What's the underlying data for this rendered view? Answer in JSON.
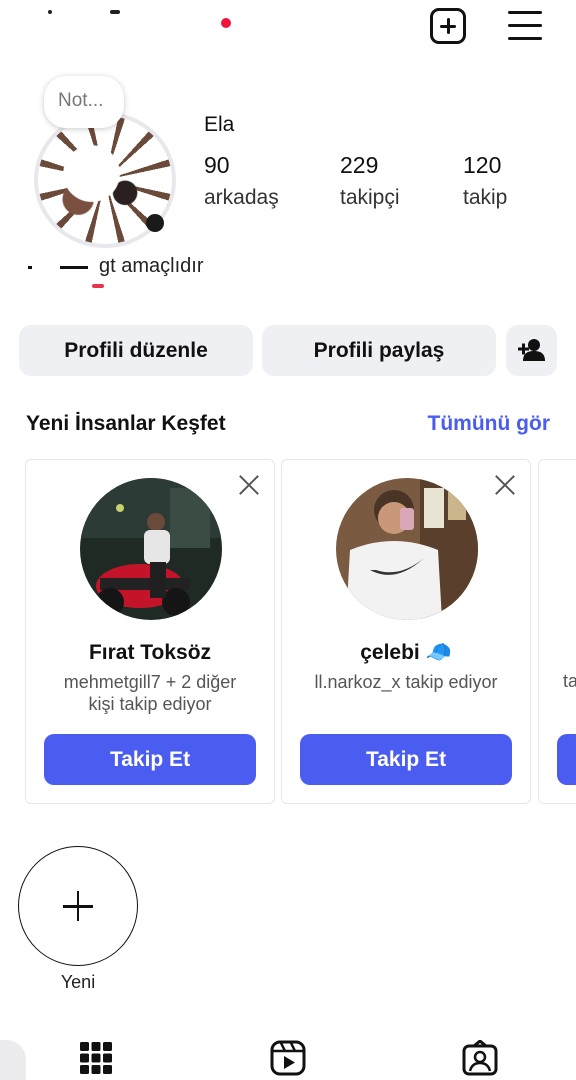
{
  "profile": {
    "note": "Not...",
    "name": "Ela",
    "bio": "gt amaçlıdır",
    "stats": [
      {
        "value": "90",
        "label": "arkadaş"
      },
      {
        "value": "229",
        "label": "takipçi"
      },
      {
        "value": "120",
        "label": "takip"
      }
    ]
  },
  "actions": {
    "edit_profile": "Profili düzenle",
    "share_profile": "Profili paylaş"
  },
  "discover": {
    "title": "Yeni İnsanlar Keşfet",
    "see_all": "Tümünü gör",
    "cards": [
      {
        "name": "Fırat Toksöz",
        "subtitle_line1": "mehmetgill7 + 2 diğer",
        "subtitle_line2": "kişi takip ediyor",
        "button": "Takip Et"
      },
      {
        "name": "çelebi 🧢",
        "subtitle_line1": "ll.narkoz_x takip ediyor",
        "subtitle_line2": "",
        "button": "Takip Et"
      }
    ],
    "partial_card_text": "ta"
  },
  "highlights": {
    "new_label": "Yeni"
  },
  "icons": {
    "create": "plus-square-icon",
    "menu": "hamburger-menu-icon",
    "invite": "add-person-icon",
    "close": "close-icon",
    "new_highlight": "plus-icon",
    "grid": "grid-icon",
    "reels": "reels-icon",
    "tagged": "tagged-person-icon"
  },
  "colors": {
    "accent": "#4a5df0",
    "button_bg": "#eef0f3"
  }
}
